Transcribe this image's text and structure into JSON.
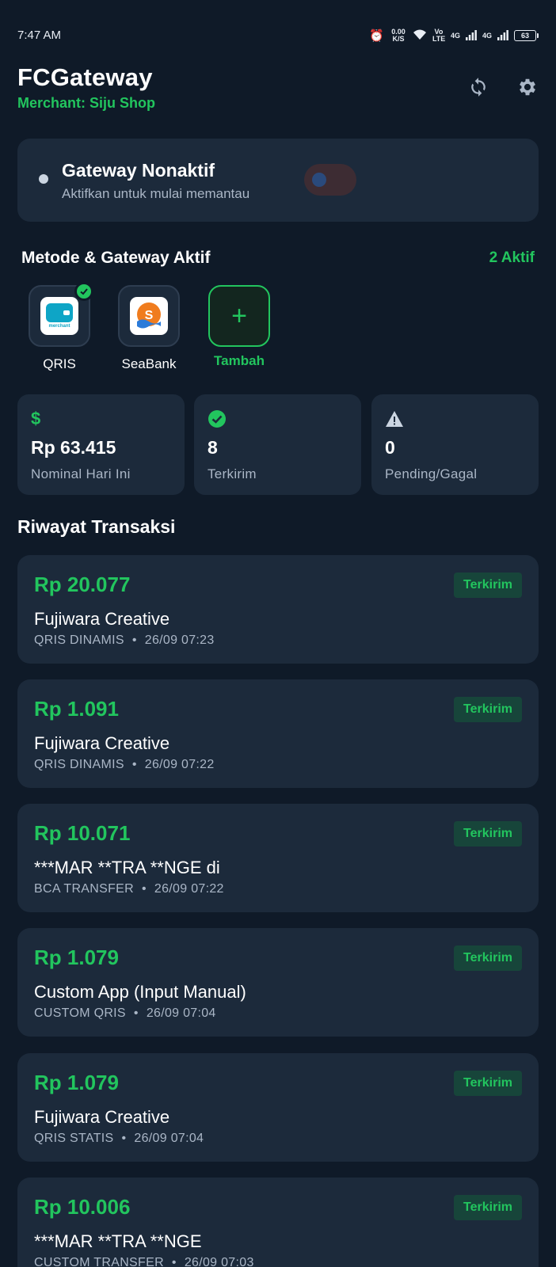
{
  "status_bar": {
    "time": "7:47 AM",
    "net_speed": "0.00 K/S",
    "volte": "Vo LTE",
    "signal_1": "4G",
    "signal_2": "4G",
    "battery": "63"
  },
  "header": {
    "title": "FCGateway",
    "merchant": "Merchant: Siju Shop",
    "actions": [
      "sync-icon",
      "gear-icon"
    ]
  },
  "gateway": {
    "title": "Gateway Nonaktif",
    "subtitle": "Aktifkan untuk mulai memantau",
    "enabled": false
  },
  "methods": {
    "title": "Metode & Gateway Aktif",
    "count": "2 Aktif",
    "items": [
      {
        "label": "QRIS",
        "logo_text": "merchant",
        "active": true
      },
      {
        "label": "SeaBank",
        "logo_text": "S",
        "active": false
      }
    ],
    "add_label": "Tambah",
    "add_symbol": "+"
  },
  "stats": [
    {
      "icon": "dollar-icon",
      "value": "Rp 63.415",
      "label": "Nominal Hari Ini",
      "color": "#22c55e"
    },
    {
      "icon": "check-circle-icon",
      "value": "8",
      "label": "Terkirim",
      "color": "#22c55e"
    },
    {
      "icon": "warning-icon",
      "value": "0",
      "label": "Pending/Gagal",
      "color": "#cbd5e1"
    }
  ],
  "stat_dollar": "$",
  "transactions": {
    "title": "Riwayat Transaksi",
    "separator": "•",
    "items": [
      {
        "amount": "Rp 20.077",
        "status": "Terkirim",
        "name": "Fujiwara Creative",
        "method": "QRIS DINAMIS",
        "time": "26/09 07:23"
      },
      {
        "amount": "Rp 1.091",
        "status": "Terkirim",
        "name": "Fujiwara Creative",
        "method": "QRIS DINAMIS",
        "time": "26/09 07:22"
      },
      {
        "amount": "Rp 10.071",
        "status": "Terkirim",
        "name": "***MAR **TRA **NGE di",
        "method": "BCA TRANSFER",
        "time": "26/09 07:22"
      },
      {
        "amount": "Rp 1.079",
        "status": "Terkirim",
        "name": "Custom App (Input Manual)",
        "method": "CUSTOM QRIS",
        "time": "26/09 07:04"
      },
      {
        "amount": "Rp 1.079",
        "status": "Terkirim",
        "name": "Fujiwara Creative",
        "method": "QRIS STATIS",
        "time": "26/09 07:04"
      },
      {
        "amount": "Rp 10.006",
        "status": "Terkirim",
        "name": "***MAR **TRA **NGE",
        "method": "CUSTOM TRANSFER",
        "time": "26/09 07:03"
      }
    ]
  },
  "colors": {
    "background": "#0f1a28",
    "card": "#1c2a3b",
    "accent": "#22c55e",
    "muted_text": "#aab6c6"
  }
}
